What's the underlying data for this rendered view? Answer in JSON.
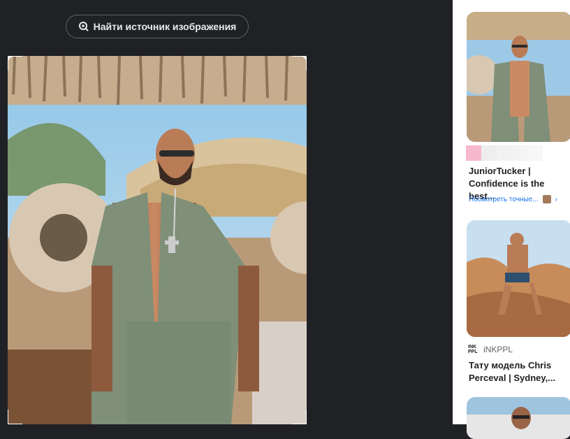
{
  "toolbar": {
    "find_source_label": "Найти источник изображения"
  },
  "results": [
    {
      "title": "JuniorTucker | Confidence is the best...",
      "action": "Посмотреть точные...",
      "swatches": [
        "#f5b8cc",
        "#eeeeee",
        "#f2f2f2",
        "#f4f4f4",
        "#f7f7f7"
      ]
    },
    {
      "source": "iNKPPL",
      "source_logo": "INK PPL",
      "title": "Тату модель Chris Perceval | Sydney,..."
    }
  ],
  "colors": {
    "page_bg": "#202124",
    "panel_bg": "#ffffff",
    "link": "#1a73e8"
  }
}
